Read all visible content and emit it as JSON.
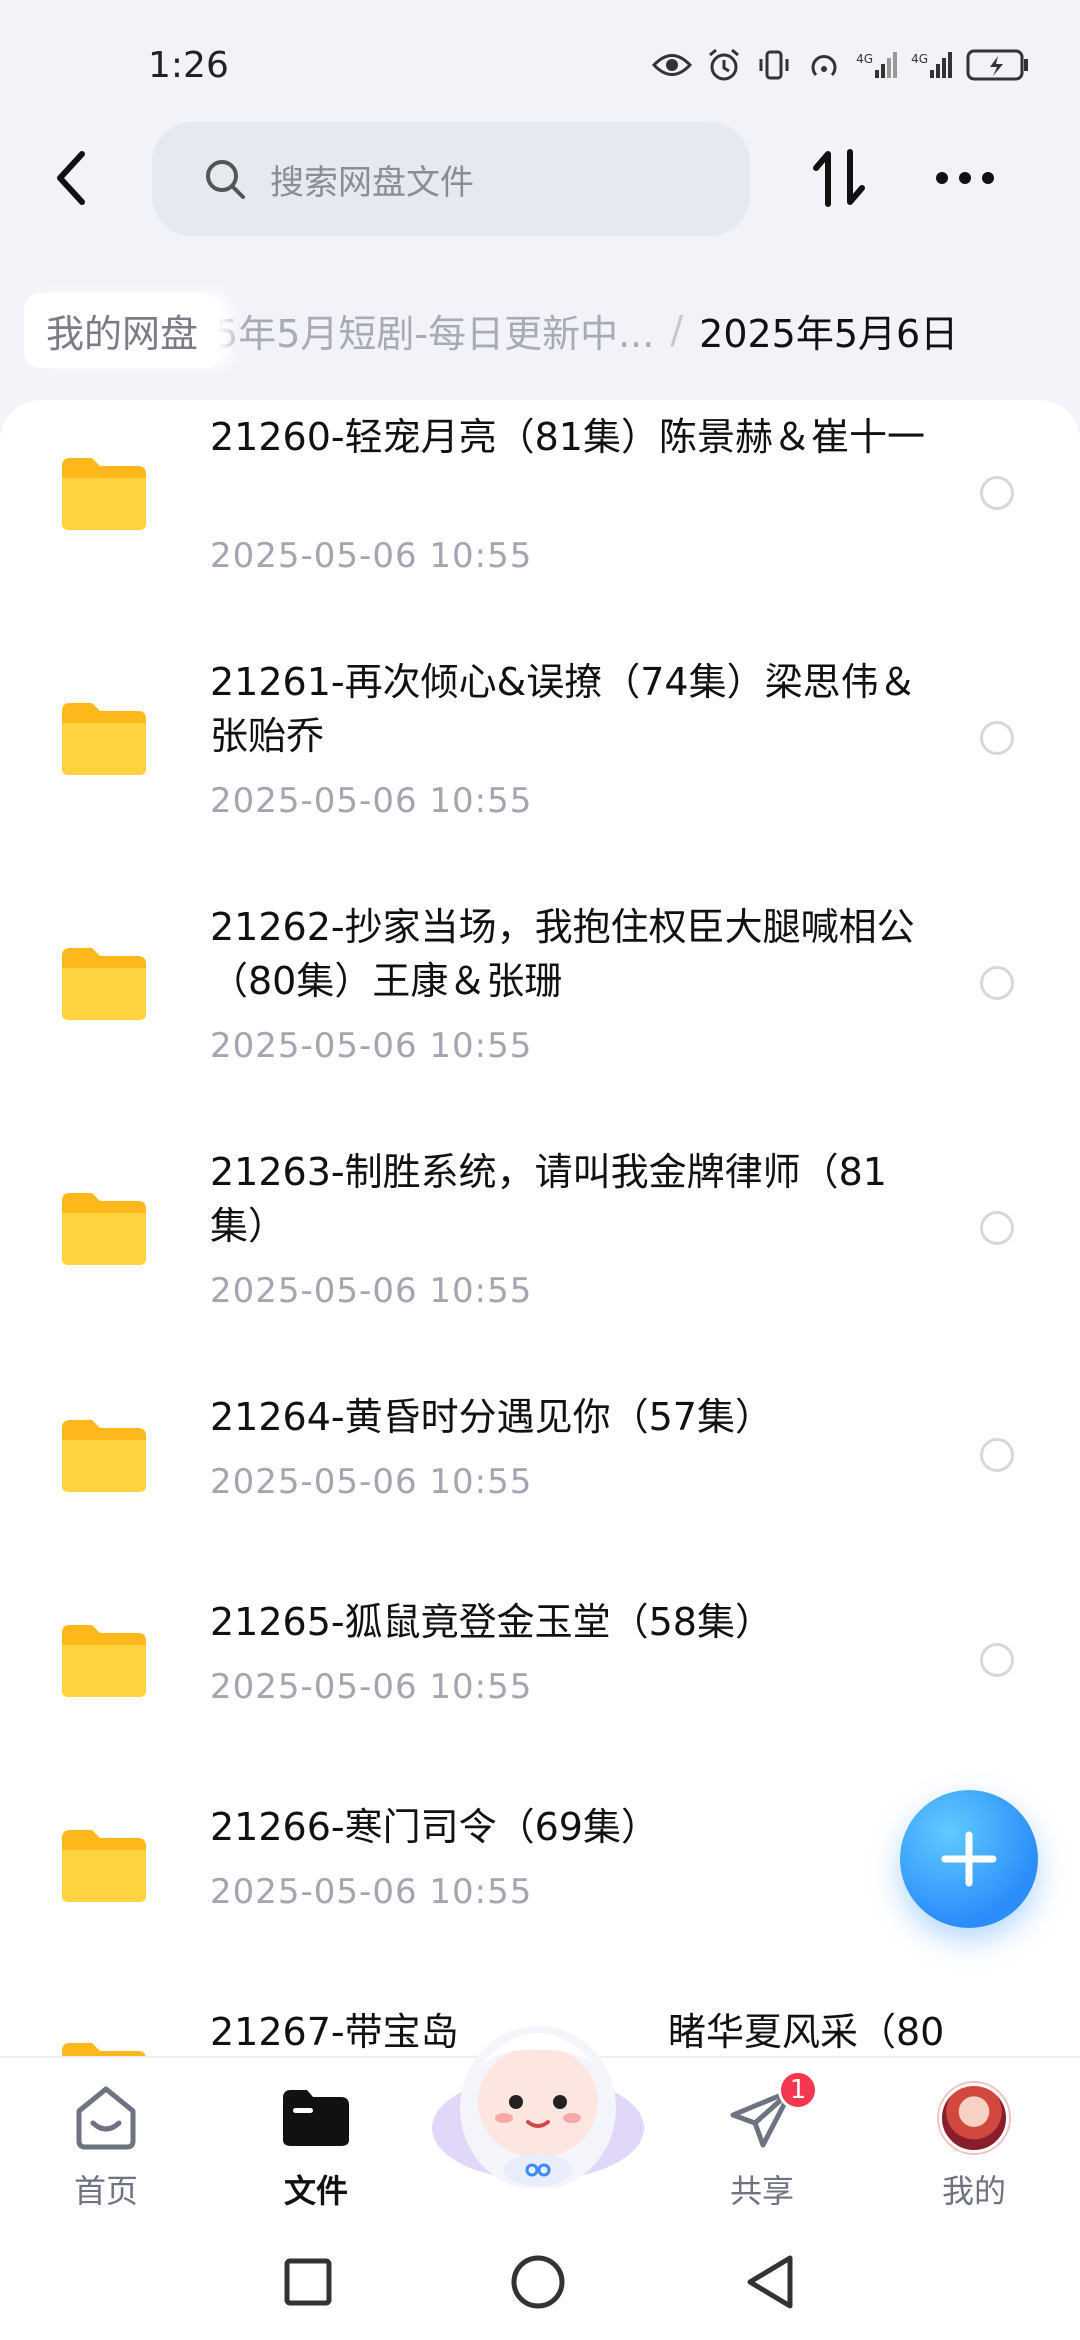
{
  "status_bar": {
    "time": "1:26",
    "icons": [
      "eye-icon",
      "alarm-icon",
      "vibrate-icon",
      "hotspot-icon",
      "signal-4g-icon",
      "signal-4g-icon",
      "battery-charging-icon"
    ],
    "network_label_1": "4G",
    "network_label_2": "4G"
  },
  "top_bar": {
    "search_placeholder": "搜索网盘文件"
  },
  "breadcrumb": {
    "root": "我的网盘",
    "middle": "5年5月短剧-每日更新中...",
    "separator": "/",
    "current": "2025年5月6日"
  },
  "files": [
    {
      "name": "21260-轻宠月亮（81集）陈景赫＆崔十一",
      "date": "2025-05-06  10:55"
    },
    {
      "name": "21261-再次倾心&误撩（74集）梁思伟＆张贻乔",
      "date": "2025-05-06  10:55"
    },
    {
      "name": "21262-抄家当场，我抱住权臣大腿喊相公（80集）王康＆张珊",
      "date": "2025-05-06  10:55"
    },
    {
      "name": "21263-制胜系统，请叫我金牌律师（81集）",
      "date": "2025-05-06  10:55"
    },
    {
      "name": "21264-黄昏时分遇见你（57集）",
      "date": "2025-05-06  10:55"
    },
    {
      "name": "21265-狐鼠竟登金玉堂（58集）",
      "date": "2025-05-06  10:55"
    },
    {
      "name": "21266-寒门司令（69集）",
      "date": "2025-05-06  10:55"
    },
    {
      "name": "21267-带宝岛",
      "name_tail": "睹华夏风采（80",
      "date": ""
    }
  ],
  "bottom_nav": {
    "home": "首页",
    "files": "文件",
    "share": "共享",
    "share_badge": "1",
    "mine": "我的"
  },
  "colors": {
    "accent": "#2b8dfb",
    "folder": "#ffc92e",
    "badge": "#f5364f"
  }
}
